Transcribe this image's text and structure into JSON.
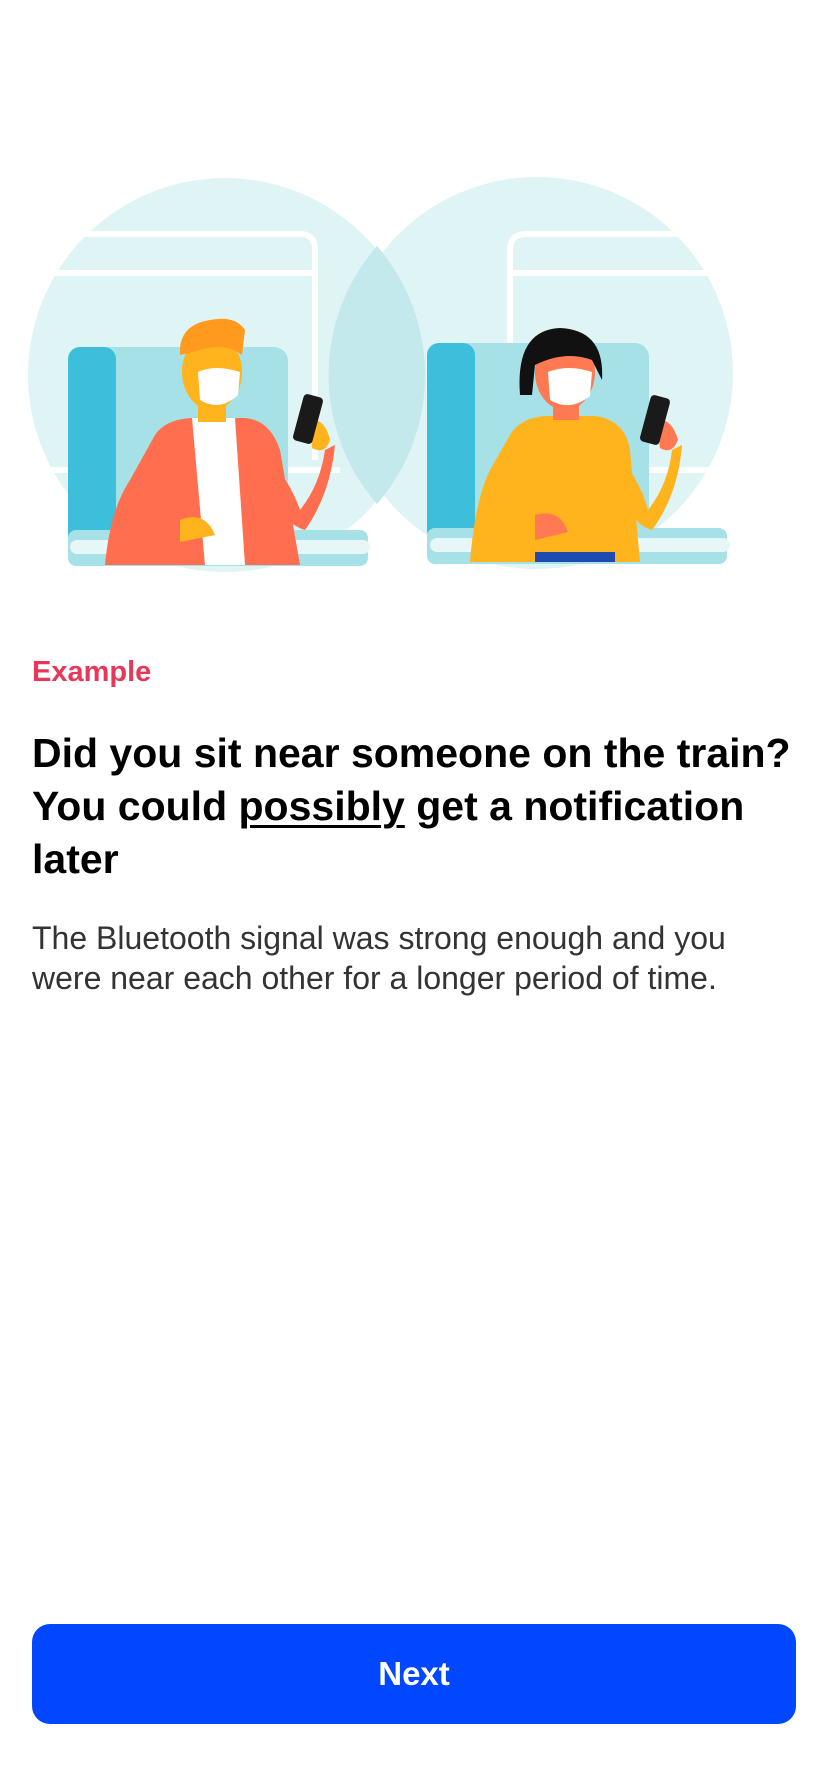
{
  "illustration": {
    "name": "train-passengers-illustration",
    "colors": {
      "circle": "#dff4f5",
      "seat": "#a7e1e8",
      "seat_dark": "#3dbfdb",
      "man_jacket": "#ff6f4f",
      "skin": "#ffb31c",
      "woman_sweater": "#ffb31c",
      "mask": "#ffffff",
      "phone": "#1a1a1a"
    }
  },
  "eyebrow": "Example",
  "title": {
    "part1": "Did you sit near someone on the train? You could ",
    "emphasis": "possibly",
    "part2": " get a notification later"
  },
  "body": "The Bluetooth signal was strong enough and you were near each other for a longer period of time.",
  "button": {
    "label": "Next",
    "color": "#0047ff"
  }
}
